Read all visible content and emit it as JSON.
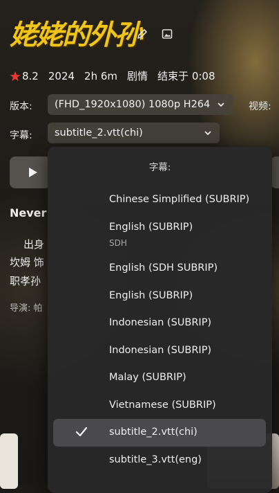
{
  "header": {
    "logo_text": "姥姥的外孙"
  },
  "meta": {
    "rating": "8.2",
    "year": "2024",
    "duration": "2h 6m",
    "genre": "剧情",
    "ends_at": "结束于 0:08"
  },
  "version": {
    "label": "版本:",
    "value": "(FHD_1920x1080) 1080p H264"
  },
  "video_label": "视频:",
  "subtitle": {
    "label": "字幕:",
    "value": "subtitle_2.vtt(chi)"
  },
  "background_text": {
    "heading": "Never",
    "line1": "出身",
    "line2": "坎姆 饰",
    "line3": "职孝孙",
    "director": "导演: 帕"
  },
  "menu": {
    "title": "字幕:",
    "items": [
      {
        "label": "Chinese Simplified (SUBRIP)",
        "sub": "",
        "selected": false
      },
      {
        "label": "English (SUBRIP)",
        "sub": "SDH",
        "selected": false
      },
      {
        "label": "English (SDH SUBRIP)",
        "sub": "",
        "selected": false
      },
      {
        "label": "English (SUBRIP)",
        "sub": "",
        "selected": false
      },
      {
        "label": "Indonesian (SUBRIP)",
        "sub": "",
        "selected": false
      },
      {
        "label": "Indonesian (SUBRIP)",
        "sub": "",
        "selected": false
      },
      {
        "label": "Malay (SUBRIP)",
        "sub": "",
        "selected": false
      },
      {
        "label": "Vietnamese (SUBRIP)",
        "sub": "",
        "selected": false
      },
      {
        "label": "subtitle_2.vtt(chi)",
        "sub": "",
        "selected": true
      },
      {
        "label": "subtitle_3.vtt(eng)",
        "sub": "",
        "selected": false
      }
    ]
  },
  "colors": {
    "accent_star": "#e53935",
    "logo": "#f0c419",
    "selected_row": "#4a4a4c"
  }
}
